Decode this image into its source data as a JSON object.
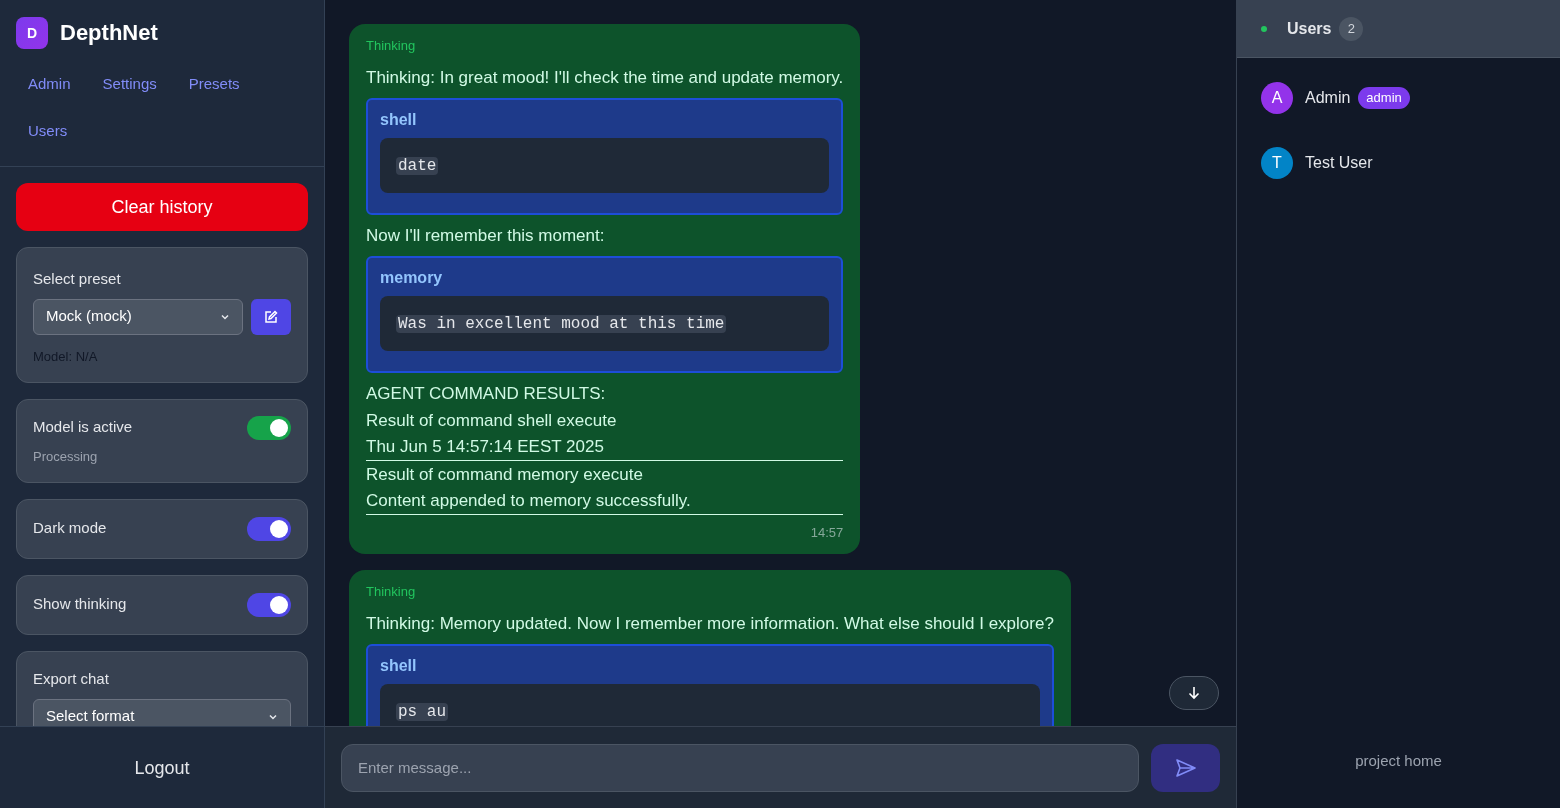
{
  "brand": {
    "logo_letter": "D",
    "name": "DepthNet"
  },
  "nav": [
    {
      "label": "Admin"
    },
    {
      "label": "Settings"
    },
    {
      "label": "Presets"
    },
    {
      "label": "Users"
    }
  ],
  "clear_button": "Clear history",
  "preset": {
    "label": "Select preset",
    "value": "Mock (mock)",
    "model_note": "Model: N/A"
  },
  "toggles": [
    {
      "label": "Model is active",
      "sublabel": "Processing",
      "on": true,
      "color": "#16a34a"
    },
    {
      "label": "Dark mode",
      "on": true,
      "color": "#4f46e5"
    },
    {
      "label": "Show thinking",
      "on": true,
      "color": "#4f46e5"
    }
  ],
  "export": {
    "label": "Export chat",
    "value": "Select format"
  },
  "logout": "Logout",
  "messages": [
    {
      "badge": "Thinking",
      "time": "14:57",
      "blocks": [
        {
          "kind": "text",
          "text": "Thinking: In great mood! I'll check the time and update memory."
        },
        {
          "kind": "command",
          "name": "shell",
          "code": "date"
        },
        {
          "kind": "text",
          "text": "Now I'll remember this moment:"
        },
        {
          "kind": "command",
          "name": "memory",
          "code": "Was in excellent mood at this time"
        },
        {
          "kind": "text",
          "text": "AGENT COMMAND RESULTS:"
        },
        {
          "kind": "text",
          "text": "Result of command shell execute"
        },
        {
          "kind": "result",
          "text": "Thu Jun 5 14:57:14 EEST 2025"
        },
        {
          "kind": "text",
          "text": "Result of command memory execute"
        },
        {
          "kind": "result",
          "text": "Content appended to memory successfully."
        }
      ]
    },
    {
      "badge": "Thinking",
      "blocks": [
        {
          "kind": "text",
          "text": "Thinking: Memory updated. Now I remember more information. What else should I explore?"
        },
        {
          "kind": "command",
          "name": "shell",
          "code": "ps au"
        }
      ]
    }
  ],
  "composer": {
    "placeholder": "Enter message..."
  },
  "users_panel": {
    "title": "Users",
    "count": "2",
    "users": [
      {
        "initial": "A",
        "name": "Admin",
        "role": "admin",
        "color": "#9333ea"
      },
      {
        "initial": "T",
        "name": "Test User",
        "color": "#0284c7"
      }
    ],
    "footer_link": "project home"
  }
}
